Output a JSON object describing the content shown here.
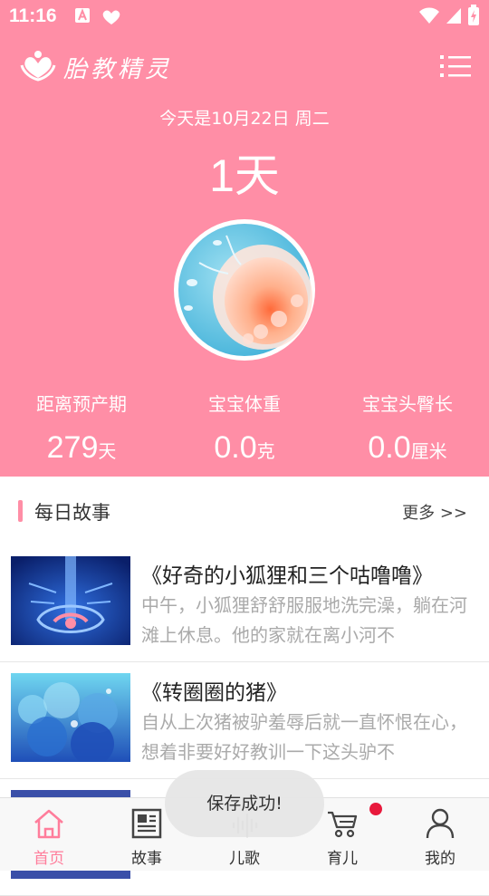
{
  "status_bar": {
    "time": "11:16"
  },
  "header": {
    "app_title": "胎教精灵",
    "date_line": "今天是10月22日 周二",
    "days_count": "1天",
    "stats": [
      {
        "label": "距离预产期",
        "value": "279",
        "unit": "天"
      },
      {
        "label": "宝宝体重",
        "value": "0.0",
        "unit": "克"
      },
      {
        "label": "宝宝头臀长",
        "value": "0.0",
        "unit": "厘米"
      }
    ]
  },
  "daily_story": {
    "title": "每日故事",
    "more": "更多 >>",
    "items": [
      {
        "title": "《好奇的小狐狸和三个咕噜噜》",
        "desc": "中午，小狐狸舒舒服服地洗完澡，躺在河滩上休息。他的家就在离小河不"
      },
      {
        "title": "《转圈圈的猪》",
        "desc": "自从上次猪被驴羞辱后就一直怀恨在心，想着非要好好教训一下这头驴不"
      }
    ]
  },
  "toast": "保存成功!",
  "bottom_nav": [
    {
      "label": "首页",
      "icon": "home-icon",
      "active": true
    },
    {
      "label": "故事",
      "icon": "news-icon",
      "active": false
    },
    {
      "label": "儿歌",
      "icon": "music-icon",
      "active": false
    },
    {
      "label": "育儿",
      "icon": "stroller-icon",
      "active": false
    },
    {
      "label": "我的",
      "icon": "person-icon",
      "active": false
    }
  ],
  "colors": {
    "brand_pink": "#ff8ea6",
    "nav_active": "#ff7d9b",
    "badge_red": "#e8193c"
  }
}
